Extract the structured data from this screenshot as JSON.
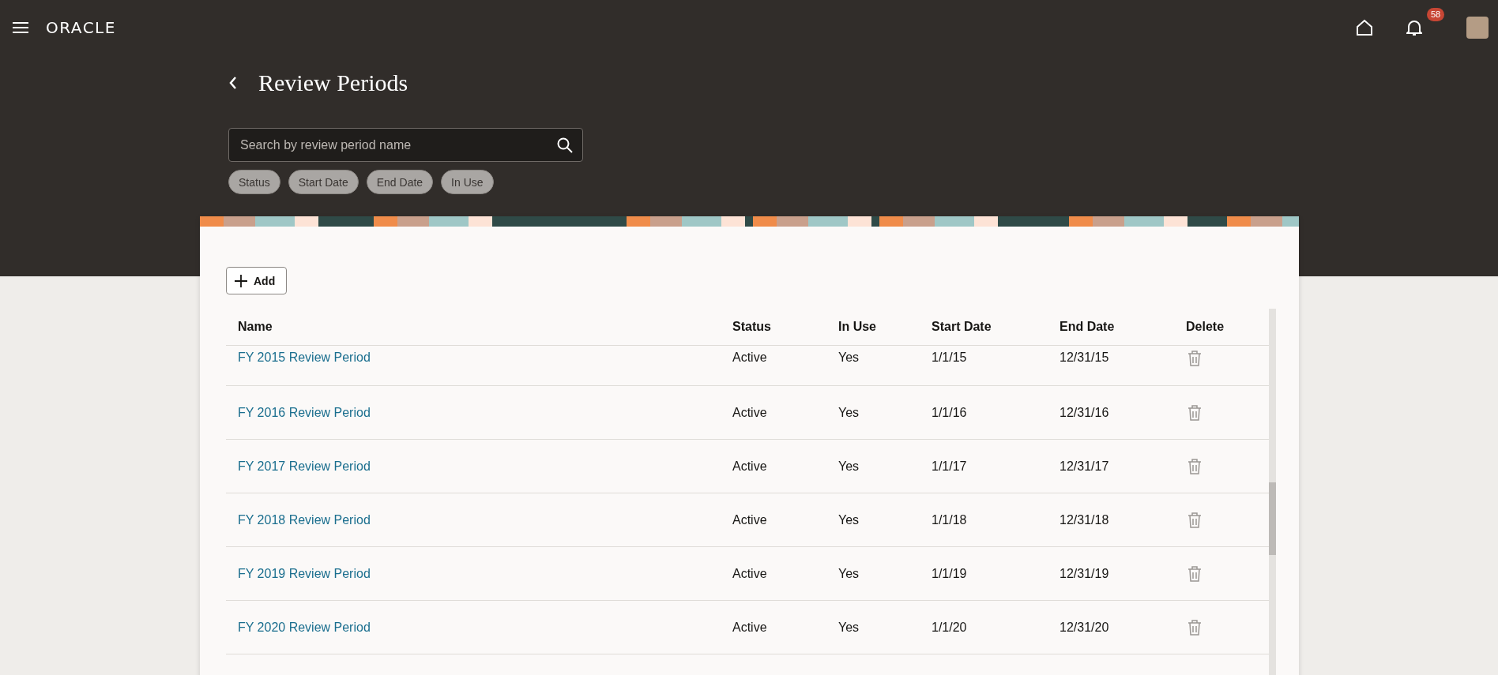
{
  "header": {
    "logo": "ORACLE",
    "notifications": "58"
  },
  "page": {
    "title": "Review Periods"
  },
  "search": {
    "placeholder": "Search by review period name"
  },
  "filters": [
    {
      "label": "Status"
    },
    {
      "label": "Start Date"
    },
    {
      "label": "End Date"
    },
    {
      "label": "In Use"
    }
  ],
  "toolbar": {
    "add": "Add"
  },
  "table": {
    "columns": [
      "Name",
      "Status",
      "In Use",
      "Start Date",
      "End Date",
      "Delete"
    ],
    "rows": [
      {
        "name": "FY 2015 Review Period",
        "status": "Active",
        "in_use": "Yes",
        "start": "1/1/15",
        "end": "12/31/15"
      },
      {
        "name": "FY 2016 Review Period",
        "status": "Active",
        "in_use": "Yes",
        "start": "1/1/16",
        "end": "12/31/16"
      },
      {
        "name": "FY 2017 Review Period",
        "status": "Active",
        "in_use": "Yes",
        "start": "1/1/17",
        "end": "12/31/17"
      },
      {
        "name": "FY 2018 Review Period",
        "status": "Active",
        "in_use": "Yes",
        "start": "1/1/18",
        "end": "12/31/18"
      },
      {
        "name": "FY 2019 Review Period",
        "status": "Active",
        "in_use": "Yes",
        "start": "1/1/19",
        "end": "12/31/19"
      },
      {
        "name": "FY 2020 Review Period",
        "status": "Active",
        "in_use": "Yes",
        "start": "1/1/20",
        "end": "12/31/20"
      }
    ]
  }
}
